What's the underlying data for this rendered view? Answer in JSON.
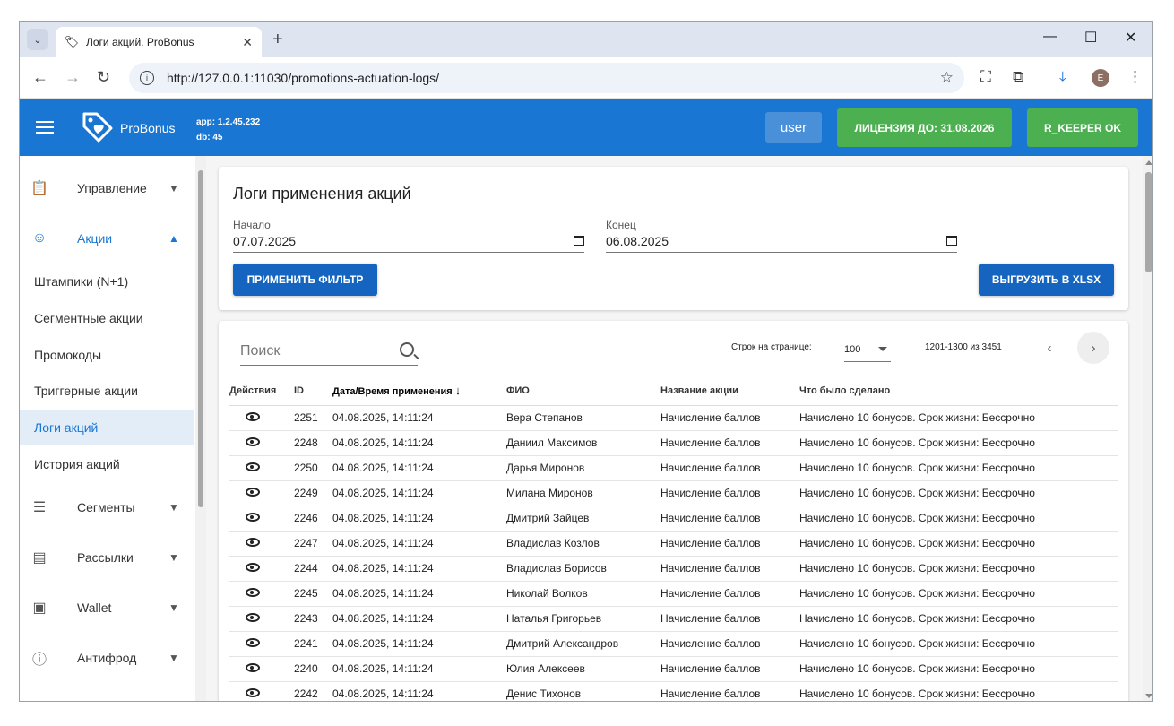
{
  "browser": {
    "tab_title": "Логи акций. ProBonus",
    "url": "http://127.0.0.1:11030/promotions-actuation-logs/",
    "profile_initial": "E"
  },
  "header": {
    "logo_text": "ProBonus",
    "app_version": "app: 1.2.45.232",
    "db_version": "db: 45",
    "user_label": "user",
    "license_label": "ЛИЦЕНЗИЯ ДО: 31.08.2026",
    "rkeeper_label": "R_KEEPER OK",
    "colors": {
      "primary": "#1976d2",
      "success": "#4caf50"
    }
  },
  "sidebar": {
    "groups": [
      {
        "label": "Управление",
        "icon": "clipboard-icon",
        "expanded": false
      },
      {
        "label": "Акции",
        "icon": "smiley-icon",
        "expanded": true
      },
      {
        "label": "Сегменты",
        "icon": "list-icon",
        "expanded": false
      },
      {
        "label": "Рассылки",
        "icon": "mail-box-icon",
        "expanded": false
      },
      {
        "label": "Wallet",
        "icon": "wallet-icon",
        "expanded": false
      },
      {
        "label": "Антифрод",
        "icon": "alert-icon",
        "expanded": false
      }
    ],
    "promo_items": [
      "Штампики (N+1)",
      "Сегментные акции",
      "Промокоды",
      "Триггерные акции",
      "Логи акций",
      "История акций"
    ],
    "active_item": "Логи акций"
  },
  "filter": {
    "title": "Логи применения акций",
    "start_label": "Начало",
    "start_value": "07.07.2025",
    "end_label": "Конец",
    "end_value": "06.08.2025",
    "apply_label": "ПРИМЕНИТЬ ФИЛЬТР",
    "export_label": "ВЫГРУЗИТЬ В XLSX"
  },
  "table": {
    "search_placeholder": "Поиск",
    "rows_per_page_label": "Строк на странице:",
    "rows_per_page": "100",
    "range": "1201-1300 из 3451",
    "columns": [
      "Действия",
      "ID",
      "Дата/Время применения",
      "ФИО",
      "Название акции",
      "Что было сделано"
    ],
    "sort_column": "Дата/Время применения",
    "sort_direction": "desc",
    "rows": [
      {
        "id": "2251",
        "date": "04.08.2025, 14:11:24",
        "name": "Вера Степанов",
        "promo": "Начисление баллов",
        "action": "Начислено 10 бонусов. Срок жизни: Бессрочно"
      },
      {
        "id": "2248",
        "date": "04.08.2025, 14:11:24",
        "name": "Даниил Максимов",
        "promo": "Начисление баллов",
        "action": "Начислено 10 бонусов. Срок жизни: Бессрочно"
      },
      {
        "id": "2250",
        "date": "04.08.2025, 14:11:24",
        "name": "Дарья Миронов",
        "promo": "Начисление баллов",
        "action": "Начислено 10 бонусов. Срок жизни: Бессрочно"
      },
      {
        "id": "2249",
        "date": "04.08.2025, 14:11:24",
        "name": "Милана Миронов",
        "promo": "Начисление баллов",
        "action": "Начислено 10 бонусов. Срок жизни: Бессрочно"
      },
      {
        "id": "2246",
        "date": "04.08.2025, 14:11:24",
        "name": "Дмитрий Зайцев",
        "promo": "Начисление баллов",
        "action": "Начислено 10 бонусов. Срок жизни: Бессрочно"
      },
      {
        "id": "2247",
        "date": "04.08.2025, 14:11:24",
        "name": "Владислав Козлов",
        "promo": "Начисление баллов",
        "action": "Начислено 10 бонусов. Срок жизни: Бессрочно"
      },
      {
        "id": "2244",
        "date": "04.08.2025, 14:11:24",
        "name": "Владислав Борисов",
        "promo": "Начисление баллов",
        "action": "Начислено 10 бонусов. Срок жизни: Бессрочно"
      },
      {
        "id": "2245",
        "date": "04.08.2025, 14:11:24",
        "name": "Николай Волков",
        "promo": "Начисление баллов",
        "action": "Начислено 10 бонусов. Срок жизни: Бессрочно"
      },
      {
        "id": "2243",
        "date": "04.08.2025, 14:11:24",
        "name": "Наталья Григорьев",
        "promo": "Начисление баллов",
        "action": "Начислено 10 бонусов. Срок жизни: Бессрочно"
      },
      {
        "id": "2241",
        "date": "04.08.2025, 14:11:24",
        "name": "Дмитрий Александров",
        "promo": "Начисление баллов",
        "action": "Начислено 10 бонусов. Срок жизни: Бессрочно"
      },
      {
        "id": "2240",
        "date": "04.08.2025, 14:11:24",
        "name": "Юлия Алексеев",
        "promo": "Начисление баллов",
        "action": "Начислено 10 бонусов. Срок жизни: Бессрочно"
      },
      {
        "id": "2242",
        "date": "04.08.2025, 14:11:24",
        "name": "Денис Тихонов",
        "promo": "Начисление баллов",
        "action": "Начислено 10 бонусов. Срок жизни: Бессрочно"
      }
    ]
  }
}
